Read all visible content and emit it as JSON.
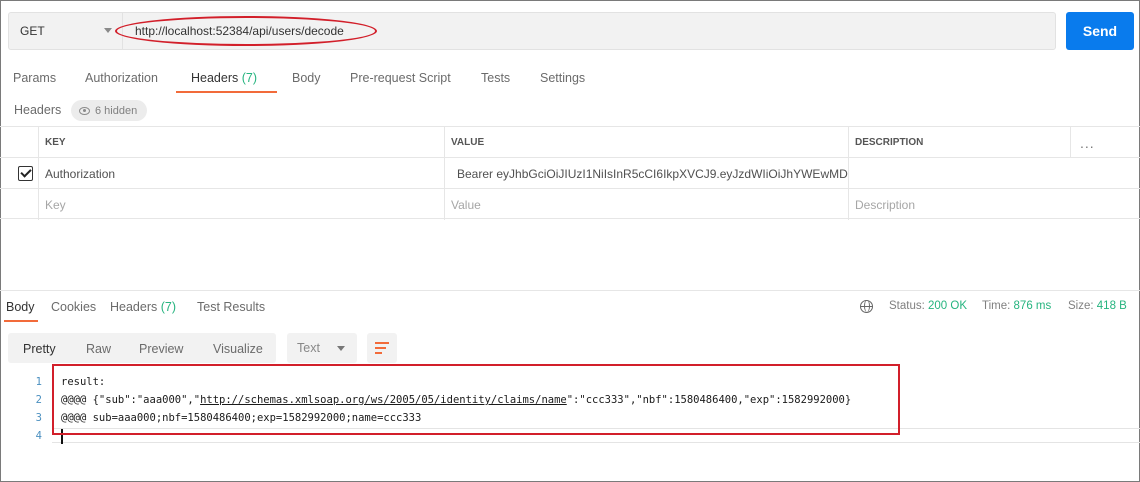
{
  "request": {
    "method": "GET",
    "url": "http://localhost:52384/api/users/decode",
    "send_label": "Send"
  },
  "tabs": [
    {
      "label": "Params",
      "count": ""
    },
    {
      "label": "Authorization",
      "count": ""
    },
    {
      "label": "Headers",
      "count": "(7)"
    },
    {
      "label": "Body",
      "count": ""
    },
    {
      "label": "Pre-request Script",
      "count": ""
    },
    {
      "label": "Tests",
      "count": ""
    },
    {
      "label": "Settings",
      "count": ""
    }
  ],
  "headers_section": {
    "label": "Headers",
    "hidden_label": "6 hidden"
  },
  "table": {
    "columns": [
      "KEY",
      "VALUE",
      "DESCRIPTION"
    ],
    "more_icon": "...",
    "rows": [
      {
        "checked": true,
        "key": "Authorization",
        "value": "Bearer eyJhbGciOiJIUzI1NiIsInR5cCI6IkpXVCJ9.eyJzdWIiOiJhYWEwMD...",
        "description": ""
      }
    ],
    "placeholder": {
      "key": "Key",
      "value": "Value",
      "description": "Description"
    }
  },
  "response_tabs": [
    {
      "label": "Body",
      "count": ""
    },
    {
      "label": "Cookies",
      "count": ""
    },
    {
      "label": "Headers",
      "count": "(7)"
    },
    {
      "label": "Test Results",
      "count": ""
    }
  ],
  "status": {
    "status_label": "Status:",
    "status_value": "200 OK",
    "time_label": "Time:",
    "time_value": "876 ms",
    "size_label": "Size:",
    "size_value": "418 B"
  },
  "view_buttons": [
    "Pretty",
    "Raw",
    "Preview",
    "Visualize"
  ],
  "format_select": "Text",
  "code": {
    "line_numbers": [
      "1",
      "2",
      "3",
      "4"
    ],
    "line1": "result:",
    "line2_pre": "@@@@ {\"sub\":\"aaa000\",\"",
    "line2_link": "http://schemas.xmlsoap.org/ws/2005/05/identity/claims/name",
    "line2_post": "\":\"ccc333\",\"nbf\":1580486400,\"exp\":1582992000}",
    "line3": "@@@@ sub=aaa000;nbf=1580486400;exp=1582992000;name=ccc333",
    "line4": ""
  },
  "colors": {
    "accent": "#f26b3a",
    "send_blue": "#097bed",
    "success_green": "#26b47f",
    "annotation_red": "#d21f2a"
  },
  "icons": {
    "method_dropdown": "chevron-down-icon",
    "hidden": "eye-icon",
    "checkbox": "checkbox-checked-icon",
    "more": "more-horizontal-icon",
    "network": "globe-icon",
    "wrap": "wrap-lines-icon"
  }
}
